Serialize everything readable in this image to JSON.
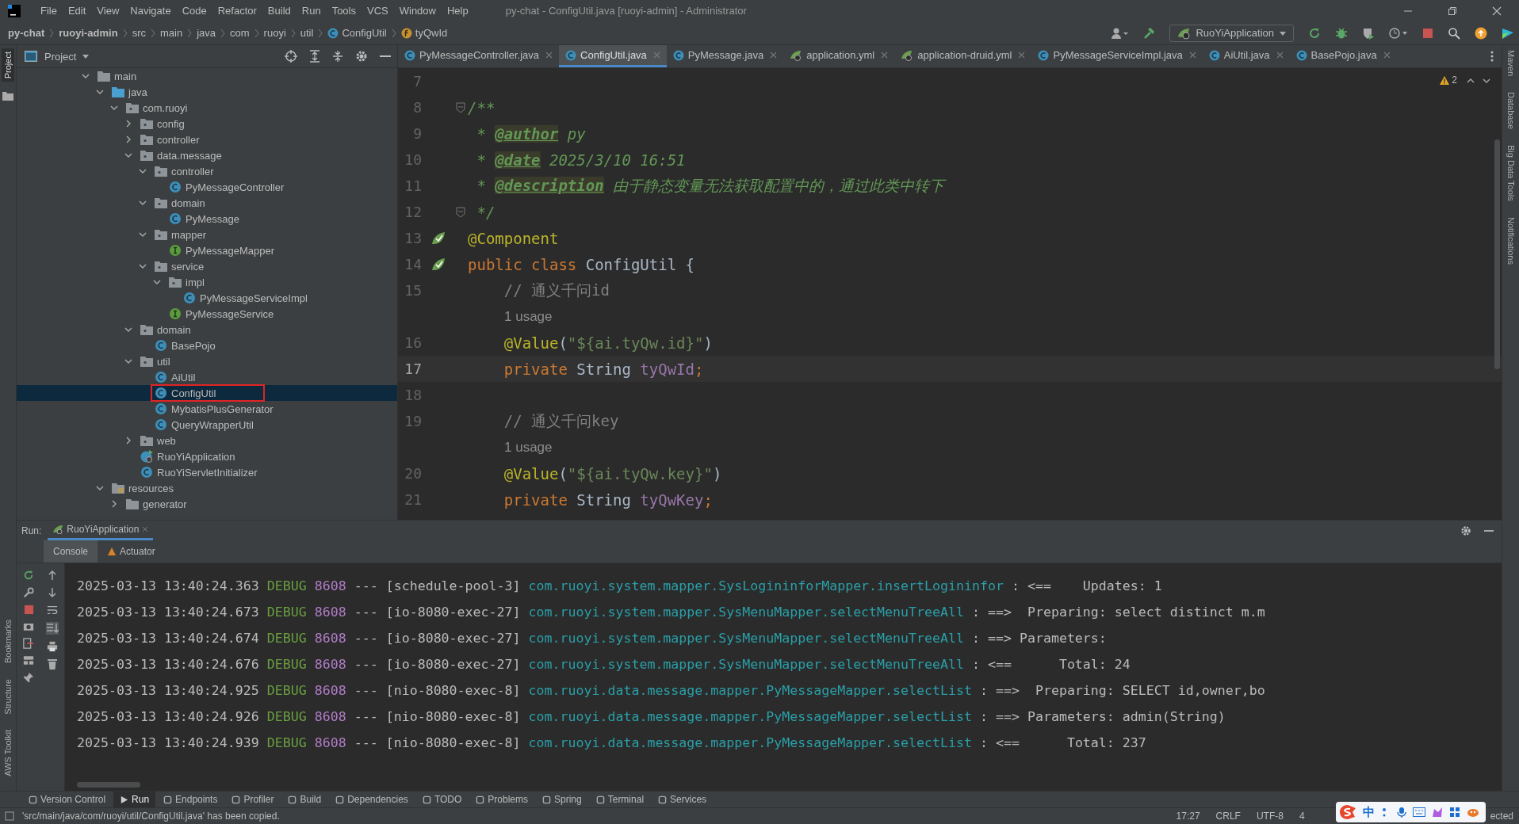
{
  "window": {
    "title": "py-chat - ConfigUtil.java [ruoyi-admin] - Administrator"
  },
  "menu": [
    "File",
    "Edit",
    "View",
    "Navigate",
    "Code",
    "Refactor",
    "Build",
    "Run",
    "Tools",
    "VCS",
    "Window",
    "Help"
  ],
  "breadcrumb": [
    {
      "label": "py-chat",
      "kind": "project"
    },
    {
      "label": "ruoyi-admin",
      "kind": "module"
    },
    {
      "label": "src",
      "kind": "dir"
    },
    {
      "label": "main",
      "kind": "dir"
    },
    {
      "label": "java",
      "kind": "dir"
    },
    {
      "label": "com",
      "kind": "dir"
    },
    {
      "label": "ruoyi",
      "kind": "dir"
    },
    {
      "label": "util",
      "kind": "dir"
    },
    {
      "label": "ConfigUtil",
      "kind": "class"
    },
    {
      "label": "tyQwId",
      "kind": "field"
    }
  ],
  "run_config": "RuoYiApplication",
  "left_stripe": {
    "top": [
      {
        "label": "Project",
        "selected": true
      }
    ],
    "bottom": [
      {
        "label": "Bookmarks",
        "selected": false
      },
      {
        "label": "Structure",
        "selected": false
      },
      {
        "label": "AWS Toolkit",
        "selected": false
      }
    ]
  },
  "project": {
    "title": "Project",
    "tree": [
      {
        "label": "main",
        "kind": "folder",
        "expanded": true,
        "selected": false,
        "children": [
          {
            "label": "java",
            "kind": "source",
            "expanded": true,
            "selected": false,
            "children": [
              {
                "label": "com.ruoyi",
                "kind": "package",
                "expanded": true,
                "selected": false,
                "children": [
                  {
                    "label": "config",
                    "kind": "package",
                    "expanded": false,
                    "selected": false
                  },
                  {
                    "label": "controller",
                    "kind": "package",
                    "expanded": false,
                    "selected": false
                  },
                  {
                    "label": "data.message",
                    "kind": "package",
                    "expanded": true,
                    "selected": false,
                    "children": [
                      {
                        "label": "controller",
                        "kind": "package",
                        "expanded": true,
                        "selected": false,
                        "children": [
                          {
                            "label": "PyMessageController",
                            "kind": "class",
                            "selected": false
                          }
                        ]
                      },
                      {
                        "label": "domain",
                        "kind": "package",
                        "expanded": true,
                        "selected": false,
                        "children": [
                          {
                            "label": "PyMessage",
                            "kind": "class",
                            "selected": false
                          }
                        ]
                      },
                      {
                        "label": "mapper",
                        "kind": "package",
                        "expanded": true,
                        "selected": false,
                        "children": [
                          {
                            "label": "PyMessageMapper",
                            "kind": "interface",
                            "selected": false
                          }
                        ]
                      },
                      {
                        "label": "service",
                        "kind": "package",
                        "expanded": true,
                        "selected": false,
                        "children": [
                          {
                            "label": "impl",
                            "kind": "package",
                            "expanded": true,
                            "selected": false,
                            "children": [
                              {
                                "label": "PyMessageServiceImpl",
                                "kind": "class",
                                "selected": false
                              }
                            ]
                          },
                          {
                            "label": "PyMessageService",
                            "kind": "interface",
                            "selected": false
                          }
                        ]
                      }
                    ]
                  },
                  {
                    "label": "domain",
                    "kind": "package",
                    "expanded": true,
                    "selected": false,
                    "children": [
                      {
                        "label": "BasePojo",
                        "kind": "class",
                        "selected": false
                      }
                    ]
                  },
                  {
                    "label": "util",
                    "kind": "package",
                    "expanded": true,
                    "selected": false,
                    "children": [
                      {
                        "label": "AiUtil",
                        "kind": "class",
                        "selected": false
                      },
                      {
                        "label": "ConfigUtil",
                        "kind": "class",
                        "selected": true,
                        "outlined": true
                      },
                      {
                        "label": "MybatisPlusGenerator",
                        "kind": "class",
                        "selected": false
                      },
                      {
                        "label": "QueryWrapperUtil",
                        "kind": "class",
                        "selected": false
                      }
                    ]
                  },
                  {
                    "label": "web",
                    "kind": "package",
                    "expanded": false,
                    "selected": false
                  },
                  {
                    "label": "RuoYiApplication",
                    "kind": "app",
                    "selected": false
                  },
                  {
                    "label": "RuoYiServletInitializer",
                    "kind": "class",
                    "selected": false
                  }
                ]
              }
            ]
          },
          {
            "label": "resources",
            "kind": "resources",
            "expanded": true,
            "selected": false,
            "children": [
              {
                "label": "generator",
                "kind": "folder",
                "expanded": false,
                "selected": false
              }
            ]
          }
        ]
      }
    ]
  },
  "editor_tabs": [
    {
      "label": "PyMessageController.java",
      "kind": "class",
      "selected": false
    },
    {
      "label": "ConfigUtil.java",
      "kind": "class",
      "selected": true
    },
    {
      "label": "PyMessage.java",
      "kind": "class",
      "selected": false
    },
    {
      "label": "application.yml",
      "kind": "config",
      "selected": false
    },
    {
      "label": "application-druid.yml",
      "kind": "config",
      "selected": false
    },
    {
      "label": "PyMessageServiceImpl.java",
      "kind": "class",
      "selected": false
    },
    {
      "label": "AiUtil.java",
      "kind": "class",
      "selected": false
    },
    {
      "label": "BasePojo.java",
      "kind": "class",
      "selected": false
    }
  ],
  "editor": {
    "warnings": "2",
    "lines": [
      {
        "kind": "code",
        "number": "7",
        "current": false
      },
      {
        "kind": "code",
        "number": "8",
        "current": false,
        "gutter": {
          "kind": "fold"
        },
        "tokens": [
          {
            "t": "/**",
            "kind": "doc"
          }
        ]
      },
      {
        "kind": "code",
        "number": "9",
        "current": false,
        "tokens": [
          {
            "t": " * ",
            "kind": "doc"
          },
          {
            "t": "@author",
            "kind": "doc-tag"
          },
          {
            "t": " py",
            "kind": "doc"
          }
        ]
      },
      {
        "kind": "code",
        "number": "10",
        "current": false,
        "tokens": [
          {
            "t": " * ",
            "kind": "doc"
          },
          {
            "t": "@date",
            "kind": "doc-tag"
          },
          {
            "t": " 2025/3/10 16:51",
            "kind": "doc"
          }
        ]
      },
      {
        "kind": "code",
        "number": "11",
        "current": false,
        "tokens": [
          {
            "t": " * ",
            "kind": "doc"
          },
          {
            "t": "@description",
            "kind": "doc-tag"
          },
          {
            "t": " 由于静态变量无法获取配置中的，通过此类中转下",
            "kind": "doc"
          }
        ]
      },
      {
        "kind": "code",
        "number": "12",
        "current": false,
        "gutter": {
          "kind": "fold"
        },
        "tokens": [
          {
            "t": " */",
            "kind": "doc"
          }
        ]
      },
      {
        "kind": "code",
        "number": "13",
        "current": false,
        "gutter": {
          "kind": "bean"
        },
        "tokens": [
          {
            "t": "@Component",
            "kind": "annotation"
          }
        ]
      },
      {
        "kind": "code",
        "number": "14",
        "current": false,
        "gutter": {
          "kind": "bean"
        },
        "tokens": [
          {
            "t": "public class ",
            "kind": "keyword"
          },
          {
            "t": "ConfigUtil {",
            "kind": "plain"
          }
        ]
      },
      {
        "kind": "code",
        "number": "15",
        "current": false,
        "tokens": [
          {
            "t": "    // 通义千问id",
            "kind": "comment"
          }
        ]
      },
      {
        "kind": "hint",
        "text": "1 usage"
      },
      {
        "kind": "code",
        "number": "16",
        "current": false,
        "tokens": [
          {
            "t": "    @Value",
            "kind": "annotation"
          },
          {
            "t": "(",
            "kind": "plain"
          },
          {
            "t": "\"${ai.tyQw.id}\"",
            "kind": "string"
          },
          {
            "t": ")",
            "kind": "plain"
          }
        ]
      },
      {
        "kind": "code",
        "number": "17",
        "current": true,
        "tokens": [
          {
            "t": "    private ",
            "kind": "keyword"
          },
          {
            "t": "String ",
            "kind": "plain"
          },
          {
            "t": "tyQwId",
            "kind": "field"
          },
          {
            "t": ";",
            "kind": "keyword"
          }
        ]
      },
      {
        "kind": "code",
        "number": "18",
        "current": false
      },
      {
        "kind": "code",
        "number": "19",
        "current": false,
        "tokens": [
          {
            "t": "    // 通义千问key",
            "kind": "comment"
          }
        ]
      },
      {
        "kind": "hint",
        "text": "1 usage"
      },
      {
        "kind": "code",
        "number": "20",
        "current": false,
        "tokens": [
          {
            "t": "    @Value",
            "kind": "annotation"
          },
          {
            "t": "(",
            "kind": "plain"
          },
          {
            "t": "\"${ai.tyQw.key}\"",
            "kind": "string"
          },
          {
            "t": ")",
            "kind": "plain"
          }
        ]
      },
      {
        "kind": "code",
        "number": "21",
        "current": false,
        "tokens": [
          {
            "t": "    private ",
            "kind": "keyword"
          },
          {
            "t": "String ",
            "kind": "plain"
          },
          {
            "t": "tyQwKey",
            "kind": "field"
          },
          {
            "t": ";",
            "kind": "keyword"
          }
        ]
      }
    ]
  },
  "right_stripe": [
    "Maven",
    "Database",
    "Big Data Tools",
    "Notifications"
  ],
  "run": {
    "label": "Run:",
    "config_tab": "RuoYiApplication",
    "tabs": [
      {
        "label": "Console",
        "selected": true
      },
      {
        "label": "Actuator",
        "selected": false
      }
    ],
    "console": [
      {
        "time": "2025-03-13 13:40:24.363",
        "level": "DEBUG",
        "pid": "8608",
        "sep": "---",
        "thread": "[schedule-pool-3]",
        "logger": "com.ruoyi.system.mapper.SysLogininforMapper.insertLogininfor",
        "message": ": <==    Updates: 1"
      },
      {
        "time": "2025-03-13 13:40:24.673",
        "level": "DEBUG",
        "pid": "8608",
        "sep": "---",
        "thread": "[io-8080-exec-27]",
        "logger": "com.ruoyi.system.mapper.SysMenuMapper.selectMenuTreeAll",
        "message": ": ==>  Preparing: select distinct m.m"
      },
      {
        "time": "2025-03-13 13:40:24.674",
        "level": "DEBUG",
        "pid": "8608",
        "sep": "---",
        "thread": "[io-8080-exec-27]",
        "logger": "com.ruoyi.system.mapper.SysMenuMapper.selectMenuTreeAll",
        "message": ": ==> Parameters:"
      },
      {
        "time": "2025-03-13 13:40:24.676",
        "level": "DEBUG",
        "pid": "8608",
        "sep": "---",
        "thread": "[io-8080-exec-27]",
        "logger": "com.ruoyi.system.mapper.SysMenuMapper.selectMenuTreeAll",
        "message": ": <==      Total: 24"
      },
      {
        "time": "2025-03-13 13:40:24.925",
        "level": "DEBUG",
        "pid": "8608",
        "sep": "---",
        "thread": "[nio-8080-exec-8]",
        "logger": "com.ruoyi.data.message.mapper.PyMessageMapper.selectList",
        "message": ": ==>  Preparing: SELECT id,owner,bo"
      },
      {
        "time": "2025-03-13 13:40:24.926",
        "level": "DEBUG",
        "pid": "8608",
        "sep": "---",
        "thread": "[nio-8080-exec-8]",
        "logger": "com.ruoyi.data.message.mapper.PyMessageMapper.selectList",
        "message": ": ==> Parameters: admin(String)"
      },
      {
        "time": "2025-03-13 13:40:24.939",
        "level": "DEBUG",
        "pid": "8608",
        "sep": "---",
        "thread": "[nio-8080-exec-8]",
        "logger": "com.ruoyi.data.message.mapper.PyMessageMapper.selectList",
        "message": ": <==      Total: 237"
      }
    ]
  },
  "tool_windows": [
    {
      "label": "Version Control",
      "selected": false
    },
    {
      "label": "Run",
      "selected": true
    },
    {
      "label": "Endpoints",
      "selected": false
    },
    {
      "label": "Profiler",
      "selected": false
    },
    {
      "label": "Build",
      "selected": false
    },
    {
      "label": "Dependencies",
      "selected": false
    },
    {
      "label": "TODO",
      "selected": false
    },
    {
      "label": "Problems",
      "selected": false
    },
    {
      "label": "Spring",
      "selected": false
    },
    {
      "label": "Terminal",
      "selected": false
    },
    {
      "label": "Services",
      "selected": false
    }
  ],
  "status_bar": {
    "message": "'src/main/java/com/ruoyi/util/ConfigUtil.java' has been copied.",
    "items": [
      "17:27",
      "CRLF",
      "UTF-8",
      "4"
    ],
    "tail": "ected",
    "ime": "中"
  }
}
